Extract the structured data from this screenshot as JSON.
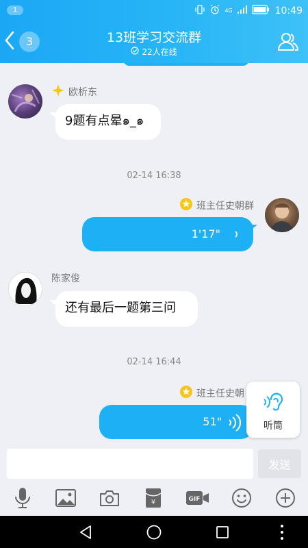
{
  "status_bar": {
    "badge": "1",
    "network": "4G",
    "time": "10:49"
  },
  "header": {
    "back_count": "3",
    "title": "13班学习交流群",
    "subtitle": "22人在线"
  },
  "messages": [
    {
      "type": "text",
      "direction": "in",
      "sender": "欧析东",
      "text": "9题有点晕๑_๑"
    },
    {
      "type": "timestamp",
      "text": "02-14 16:38"
    },
    {
      "type": "voice",
      "direction": "out",
      "sender": "班主任史朝群",
      "duration": "1'17\""
    },
    {
      "type": "text",
      "direction": "in",
      "sender": "陈家俊",
      "text": "还有最后一题第三问"
    },
    {
      "type": "timestamp",
      "text": "02-14 16:44"
    },
    {
      "type": "voice",
      "direction": "out",
      "sender": "班主任史朝",
      "duration": "51\""
    }
  ],
  "earpiece": {
    "label": "听筒"
  },
  "input": {
    "placeholder": "",
    "send_label": "发送"
  },
  "toolbar": [
    "microphone-icon",
    "image-icon",
    "camera-icon",
    "red-packet-icon",
    "gif-icon",
    "emoji-icon",
    "plus-icon"
  ],
  "colors": {
    "accent": "#1eb0f5",
    "background": "#eef0f5",
    "star": "#f5c518"
  }
}
